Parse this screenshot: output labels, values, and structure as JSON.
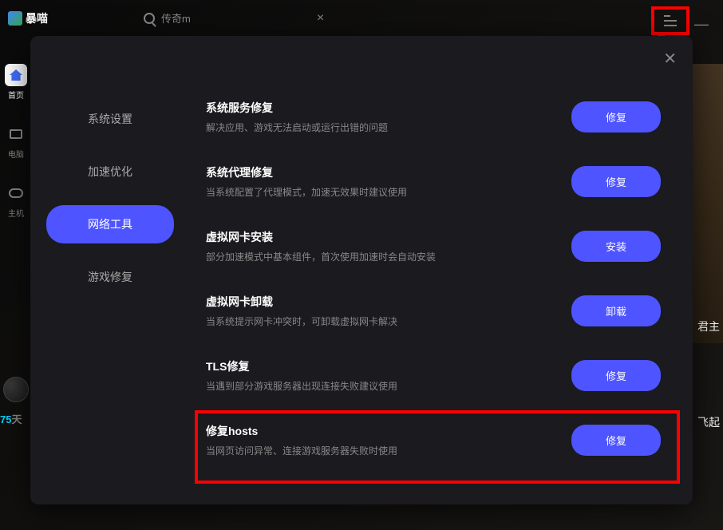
{
  "app": {
    "name": "暴喵"
  },
  "topbar": {
    "search_text": "传奇m"
  },
  "left_nav": {
    "items": [
      {
        "label": "首页"
      },
      {
        "label": "电脑"
      },
      {
        "label": "主机"
      }
    ]
  },
  "user": {
    "days_num": "75",
    "days_unit": "天"
  },
  "bg": {
    "text1": "君主",
    "text2": "飞起"
  },
  "modal": {
    "sidebar": {
      "items": [
        {
          "label": "系统设置"
        },
        {
          "label": "加速优化"
        },
        {
          "label": "网络工具"
        },
        {
          "label": "游戏修复"
        }
      ]
    },
    "tools": [
      {
        "title": "系统服务修复",
        "desc": "解决应用、游戏无法启动或运行出错的问题",
        "btn": "修复"
      },
      {
        "title": "系统代理修复",
        "desc": "当系统配置了代理模式，加速无效果时建议使用",
        "btn": "修复"
      },
      {
        "title": "虚拟网卡安装",
        "desc": "部分加速模式中基本组件，首次使用加速时会自动安装",
        "btn": "安装"
      },
      {
        "title": "虚拟网卡卸载",
        "desc": "当系统提示网卡冲突时，可卸载虚拟网卡解决",
        "btn": "卸载"
      },
      {
        "title": "TLS修复",
        "desc": "当遇到部分游戏服务器出现连接失败建议使用",
        "btn": "修复"
      },
      {
        "title": "修复hosts",
        "desc": "当网页访问异常、连接游戏服务器失败时使用",
        "btn": "修复"
      }
    ]
  }
}
